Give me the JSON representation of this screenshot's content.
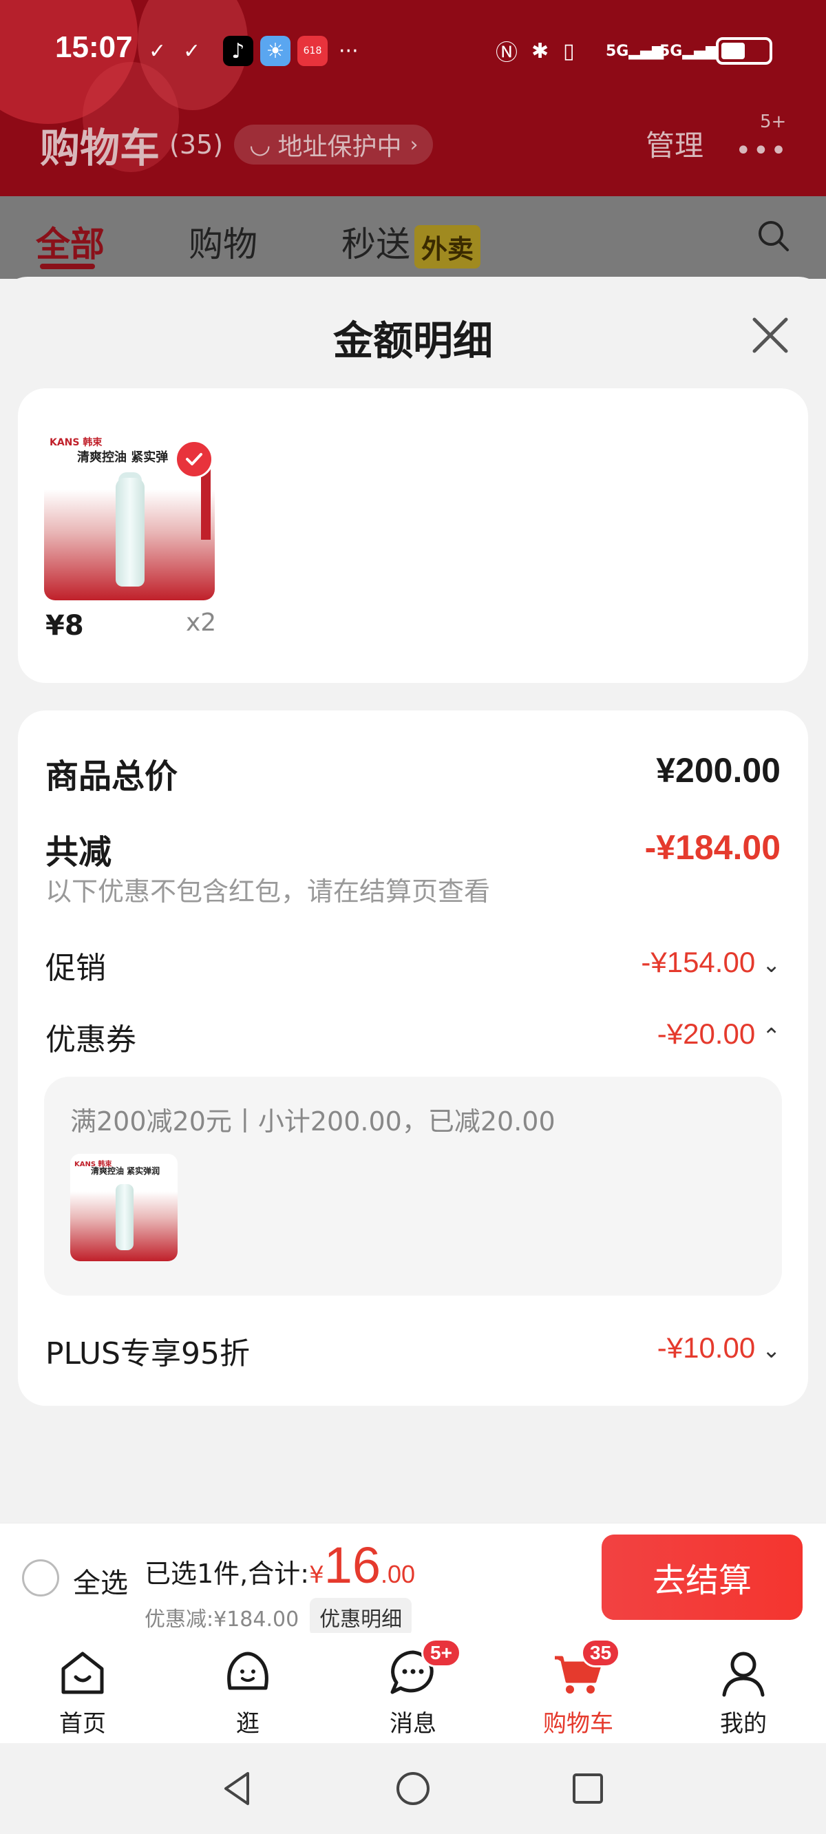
{
  "status_bar": {
    "time": "15:07",
    "network": "5G",
    "app_badge": "618"
  },
  "header": {
    "title": "购物车",
    "count": "(35)",
    "address_protect": "地址保护中",
    "manage": "管理",
    "more_badge": "5+"
  },
  "tabs": [
    {
      "label": "全部",
      "active": true
    },
    {
      "label": "购物",
      "active": false
    },
    {
      "label": "秒送",
      "active": false,
      "tag": "外卖"
    }
  ],
  "modal": {
    "title": "金额明细",
    "product": {
      "brand": "KANS 韩束",
      "slogan": "清爽控油 紧实弹",
      "price": "¥8",
      "quantity": "x2"
    },
    "breakdown": {
      "total_label": "商品总价",
      "total_value": "¥200.00",
      "reduction_label": "共减",
      "reduction_value": "-¥184.00",
      "note": "以下优惠不包含红包，请在结算页查看",
      "promo_label": "促销",
      "promo_value": "-¥154.00",
      "coupon_label": "优惠券",
      "coupon_value": "-¥20.00",
      "coupon_detail": "满200减20元丨小计200.00，已减20.00",
      "coupon_item_slogan": "清爽控油 紧实弹润",
      "plus_label": "PLUS专享95折",
      "plus_value": "-¥10.00"
    }
  },
  "checkout": {
    "select_all": "全选",
    "selected_text": "已选1件,合计:",
    "currency": "¥",
    "total_int": "16",
    "total_dec": ".00",
    "discount_text": "优惠减:¥184.00",
    "detail_button": "优惠明细",
    "checkout_button": "去结算"
  },
  "tabbar": [
    {
      "label": "首页",
      "icon": "home-icon"
    },
    {
      "label": "逛",
      "icon": "browse-icon"
    },
    {
      "label": "消息",
      "icon": "message-icon",
      "badge": "5+"
    },
    {
      "label": "购物车",
      "icon": "cart-icon",
      "badge": "35",
      "active": true
    },
    {
      "label": "我的",
      "icon": "profile-icon"
    }
  ],
  "colors": {
    "accent": "#e53a2d",
    "header_bg": "#8e0a16",
    "checkout_button": "#f24242"
  }
}
